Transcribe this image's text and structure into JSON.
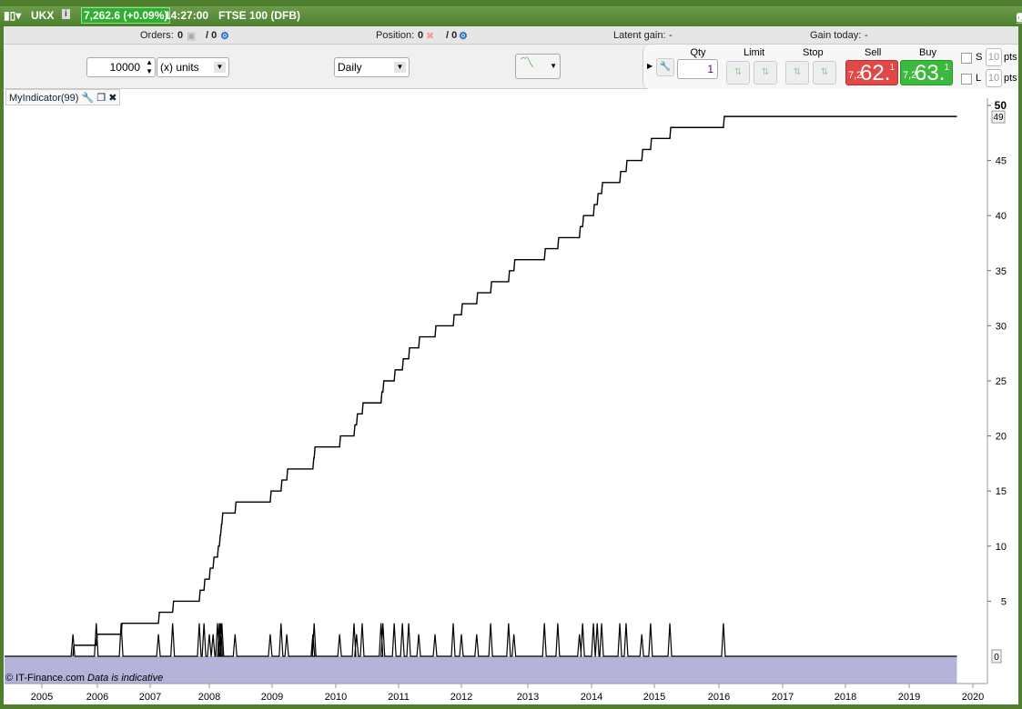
{
  "titlebar": {
    "symbol": "UKX",
    "price": "7,262.6 (+0.09%)",
    "time": "14:27:00",
    "instrument": "FTSE 100 (DFB)",
    "price_color": "#2fae2f"
  },
  "info": {
    "orders_label": "Orders:",
    "orders_value": "0",
    "orders_sep": "/ 0",
    "position_label": "Position:",
    "position_value": "0",
    "position_sep": "/ 0",
    "latent_label": "Latent gain:",
    "latent_value": "-",
    "gain_today_label": "Gain today:",
    "gain_today_value": "-"
  },
  "toolbar": {
    "amount": "10000",
    "unit": "(x) units",
    "period": "Daily"
  },
  "trade": {
    "qty_label": "Qty",
    "qty": "1",
    "limit_label": "Limit",
    "stop_label": "Stop",
    "sell_label": "Sell",
    "buy_label": "Buy",
    "sell_prefix": "7,2",
    "sell_big": "62.",
    "sell_sup": "1",
    "buy_prefix": "7,2",
    "buy_big": "63.",
    "buy_sup": "1",
    "s_label": "S",
    "l_label": "L",
    "s_pts": "10",
    "l_pts": "10",
    "pts_label": "pts",
    "sell_color": "#e04848",
    "buy_color": "#3cb93c"
  },
  "indicator": {
    "name": "MyIndicator(99)"
  },
  "footer": {
    "copyright": "© IT-Finance.com",
    "note": "Data is indicative"
  },
  "chart_data": {
    "type": "line",
    "x_ticks": [
      "2005",
      "2006",
      "2007",
      "2008",
      "2009",
      "2010",
      "2011",
      "2012",
      "2013",
      "2014",
      "2015",
      "2016",
      "2017",
      "2018",
      "2019",
      "2020"
    ],
    "y_ticks": [
      0,
      5,
      10,
      15,
      20,
      25,
      30,
      35,
      40,
      45,
      50
    ],
    "ylim": [
      0,
      50
    ],
    "x_range": [
      2004.35,
      2019.75
    ],
    "last_value_label": "49",
    "zero_label": "0",
    "series": [
      {
        "type": "step",
        "description": "cumulative count",
        "start": 2005.56,
        "end": 2019.75
      },
      {
        "type": "spikes",
        "events": [
          [
            2005.56,
            2
          ],
          [
            2005.98,
            3
          ],
          [
            2006.45,
            3
          ],
          [
            2007.14,
            2
          ],
          [
            2007.38,
            3
          ],
          [
            2007.83,
            3
          ],
          [
            2007.91,
            3
          ],
          [
            2008.0,
            2
          ],
          [
            2008.06,
            2
          ],
          [
            2008.13,
            3
          ],
          [
            2008.16,
            3
          ],
          [
            2008.18,
            3
          ],
          [
            2008.2,
            3
          ],
          [
            2008.41,
            2
          ],
          [
            2008.97,
            2
          ],
          [
            2009.14,
            3
          ],
          [
            2009.23,
            2
          ],
          [
            2009.64,
            2
          ],
          [
            2009.66,
            3
          ],
          [
            2010.06,
            2
          ],
          [
            2010.29,
            3
          ],
          [
            2010.33,
            2
          ],
          [
            2010.42,
            3
          ],
          [
            2010.72,
            3
          ],
          [
            2010.75,
            3
          ],
          [
            2010.93,
            3
          ],
          [
            2011.06,
            3
          ],
          [
            2011.16,
            3
          ],
          [
            2011.32,
            2
          ],
          [
            2011.58,
            2
          ],
          [
            2011.87,
            3
          ],
          [
            2012.0,
            2
          ],
          [
            2012.23,
            2
          ],
          [
            2012.44,
            3
          ],
          [
            2012.71,
            3
          ],
          [
            2012.79,
            2
          ],
          [
            2013.26,
            3
          ],
          [
            2013.47,
            3
          ],
          [
            2013.81,
            2
          ],
          [
            2013.86,
            3
          ],
          [
            2014.03,
            3
          ],
          [
            2014.09,
            3
          ],
          [
            2014.16,
            3
          ],
          [
            2014.45,
            3
          ],
          [
            2014.55,
            3
          ],
          [
            2014.8,
            2
          ],
          [
            2014.94,
            3
          ],
          [
            2015.24,
            3
          ],
          [
            2016.07,
            3
          ]
        ]
      }
    ],
    "band_color": "#b4b4da"
  }
}
